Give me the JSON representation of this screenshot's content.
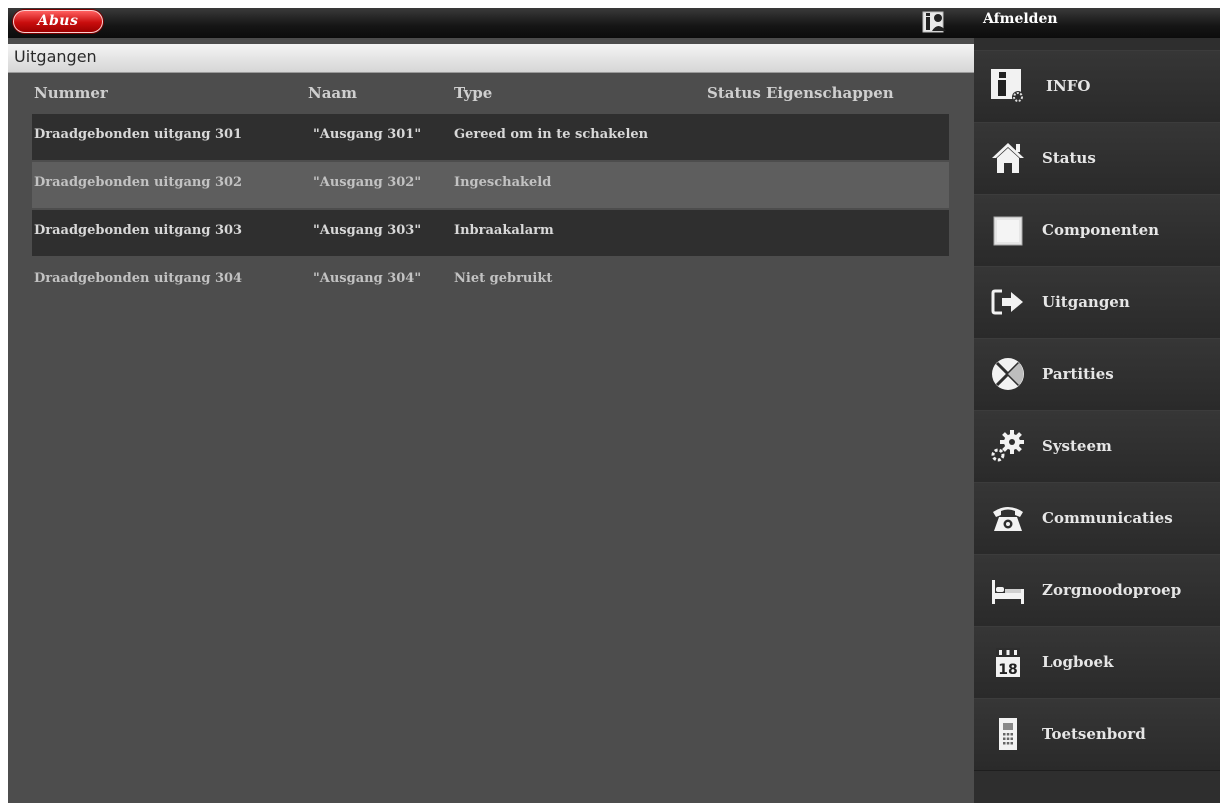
{
  "header": {
    "logo_text": "Abus",
    "logout_label": "Afmelden"
  },
  "main": {
    "title": "Uitgangen",
    "columns": {
      "number": "Nummer",
      "name": "Naam",
      "type": "Type",
      "status_props": "Status Eigenschappen"
    },
    "rows": [
      {
        "number": "Draadgebonden uitgang 301",
        "name": "\"Ausgang 301\"",
        "type": "Gereed om in te schakelen"
      },
      {
        "number": "Draadgebonden uitgang 302",
        "name": "\"Ausgang 302\"",
        "type": "Ingeschakeld"
      },
      {
        "number": "Draadgebonden uitgang 303",
        "name": "\"Ausgang 303\"",
        "type": "Inbraakalarm"
      },
      {
        "number": "Draadgebonden uitgang 304",
        "name": "\"Ausgang 304\"",
        "type": "Niet gebruikt"
      }
    ]
  },
  "sidebar": {
    "items": [
      {
        "label": "INFO",
        "icon": "info-icon"
      },
      {
        "label": "Status",
        "icon": "house-icon"
      },
      {
        "label": "Componenten",
        "icon": "component-icon"
      },
      {
        "label": "Uitgangen",
        "icon": "output-arrow-icon"
      },
      {
        "label": "Partities",
        "icon": "partition-icon"
      },
      {
        "label": "Systeem",
        "icon": "gear-icon"
      },
      {
        "label": "Communicaties",
        "icon": "telephone-icon"
      },
      {
        "label": "Zorgnoodoproep",
        "icon": "bed-icon"
      },
      {
        "label": "Logboek",
        "icon": "calendar-icon"
      },
      {
        "label": "Toetsenbord",
        "icon": "keypad-icon"
      }
    ],
    "calendar_day": "18"
  }
}
